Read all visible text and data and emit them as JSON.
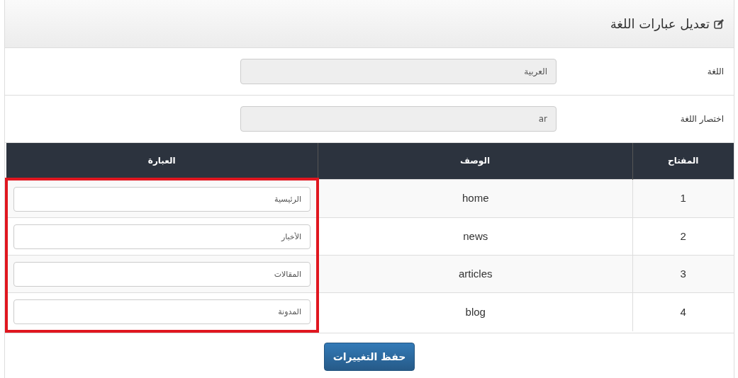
{
  "panel": {
    "title": "تعديل عبارات اللغة"
  },
  "form": [
    {
      "label": "اللغة",
      "value": "العربية",
      "disabled": true
    },
    {
      "label": "اختصار اللغة",
      "value": "ar",
      "disabled": true
    }
  ],
  "table": {
    "columns": [
      {
        "label": "المفتاح",
        "highlighted": false
      },
      {
        "label": "الوصف",
        "highlighted": false
      },
      {
        "label": "العبارة",
        "highlighted": true
      }
    ],
    "rows": [
      {
        "key": "1",
        "description": "home",
        "phrase": "الرئيسية"
      },
      {
        "key": "2",
        "description": "news",
        "phrase": "الأخبار"
      },
      {
        "key": "3",
        "description": "articles",
        "phrase": "المقالات"
      },
      {
        "key": "4",
        "description": "blog",
        "phrase": "المدونة"
      }
    ]
  },
  "save_button": "حفظ التغييرات"
}
